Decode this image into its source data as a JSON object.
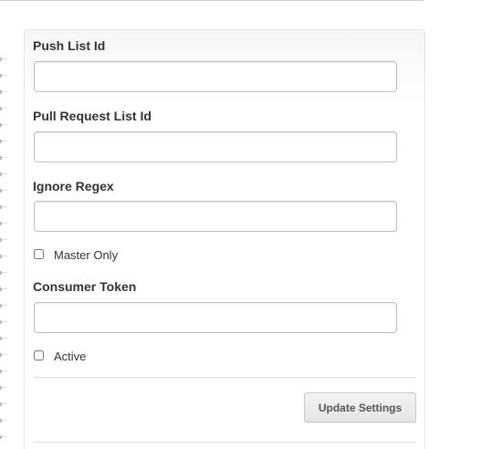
{
  "form": {
    "fields": [
      {
        "label": "Push List Id",
        "value": "",
        "placeholder": ""
      },
      {
        "label": "Pull Request List Id",
        "value": "",
        "placeholder": ""
      },
      {
        "label": "Ignore Regex",
        "value": "",
        "placeholder": ""
      },
      {
        "label": "Consumer Token",
        "value": "",
        "placeholder": ""
      }
    ],
    "checkboxes": [
      {
        "label": "Master Only",
        "checked": false
      },
      {
        "label": "Active",
        "checked": false
      }
    ],
    "submit_label": "Update Settings"
  }
}
